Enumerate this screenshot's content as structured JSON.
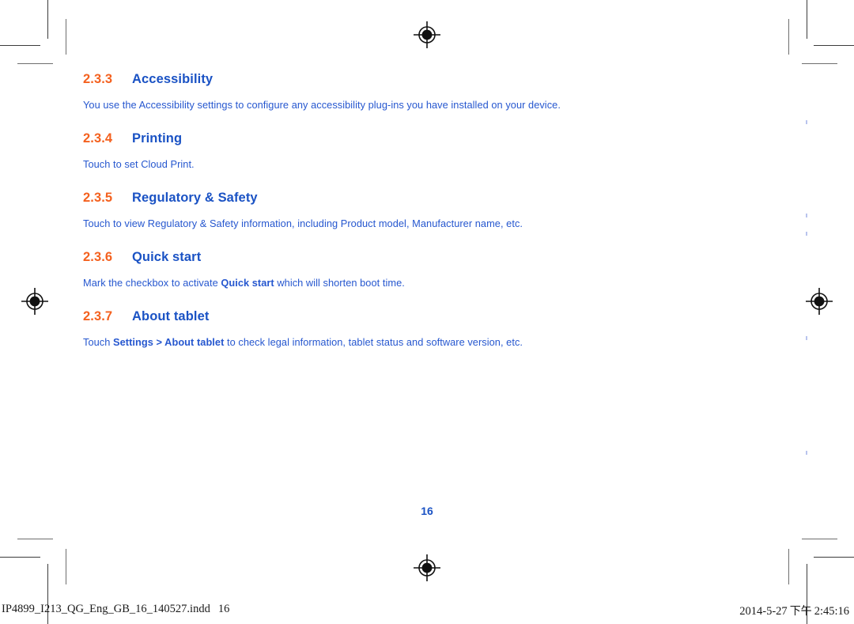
{
  "document": {
    "page_number": "16",
    "sections": [
      {
        "number": "2.3.3",
        "title": "Accessibility",
        "body_prefix": "You use the Accessibility settings to configure any accessibility plug-ins you have installed on your device.",
        "body_bold": "",
        "body_suffix": ""
      },
      {
        "number": "2.3.4",
        "title": "Printing",
        "body_prefix": "Touch to set Cloud Print.",
        "body_bold": "",
        "body_suffix": ""
      },
      {
        "number": "2.3.5",
        "title": "Regulatory & Safety",
        "body_prefix": "Touch to view Regulatory & Safety information, including Product model, Manufacturer name, etc.",
        "body_bold": "",
        "body_suffix": ""
      },
      {
        "number": "2.3.6",
        "title": "Quick start",
        "body_prefix": "Mark the checkbox to activate ",
        "body_bold": "Quick start",
        "body_suffix": " which will shorten boot time."
      },
      {
        "number": "2.3.7",
        "title": "About tablet",
        "body_prefix": "Touch ",
        "body_bold": "Settings > About tablet",
        "body_suffix": " to check legal information, tablet status and software version, etc."
      }
    ]
  },
  "footer": {
    "filename": "IP4899_I213_QG_Eng_GB_16_140527.indd",
    "file_index": "16",
    "date": "2014-5-27",
    "meridiem": "下午",
    "time": "2:45:16"
  },
  "colors": {
    "section_number": "#f4611f",
    "heading": "#1a52c4",
    "body": "#2657cf",
    "crop_mark": "#3c3c3c",
    "footer_text": "#1a1a1a"
  },
  "print_marks": {
    "registration_icon": "registration-target-icon",
    "crop_mark_icon": "crop-mark-icon"
  }
}
